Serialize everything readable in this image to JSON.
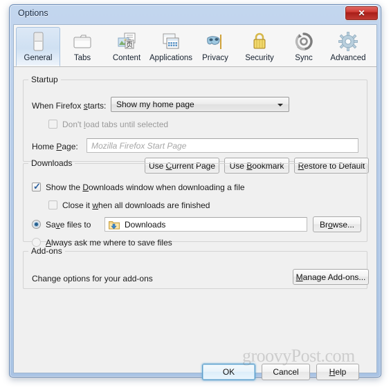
{
  "window": {
    "title": "Options",
    "close_label": "✕",
    "close_icon": "close-icon"
  },
  "tabs": [
    {
      "label": "General",
      "icon": "general-icon",
      "selected": true
    },
    {
      "label": "Tabs",
      "icon": "tabs-icon",
      "selected": false
    },
    {
      "label": "Content",
      "icon": "content-icon",
      "selected": false
    },
    {
      "label": "Applications",
      "icon": "applications-icon",
      "selected": false
    },
    {
      "label": "Privacy",
      "icon": "privacy-mask-icon",
      "selected": false
    },
    {
      "label": "Security",
      "icon": "padlock-icon",
      "selected": false
    },
    {
      "label": "Sync",
      "icon": "sync-icon",
      "selected": false
    },
    {
      "label": "Advanced",
      "icon": "gear-icon",
      "selected": false
    }
  ],
  "startup": {
    "legend": "Startup",
    "when_firefox_starts_label_a": "When Firefox ",
    "when_firefox_starts_label_b": "s",
    "when_firefox_starts_label_c": "tarts:",
    "startup_select_value": "Show my home page",
    "dont_load_tabs_a": "Don't ",
    "dont_load_tabs_b": "l",
    "dont_load_tabs_c": "oad tabs until selected",
    "dont_load_tabs_checked": false,
    "home_page_label_a": "Home ",
    "home_page_label_b": "P",
    "home_page_label_c": "age:",
    "home_page_placeholder": "Mozilla Firefox Start Page",
    "home_page_value": "",
    "use_current_page_a": "Use ",
    "use_current_page_b": "C",
    "use_current_page_c": "urrent Page",
    "use_bookmark_a": "Use ",
    "use_bookmark_b": "B",
    "use_bookmark_c": "ookmark",
    "restore_default_a": "",
    "restore_default_b": "R",
    "restore_default_c": "estore to Default"
  },
  "downloads": {
    "legend": "Downloads",
    "show_window_a": "Show the ",
    "show_window_b": "D",
    "show_window_c": "ownloads window when downloading a file",
    "show_window_checked": true,
    "close_when_done_a": "Close it ",
    "close_when_done_b": "w",
    "close_when_done_c": "hen all downloads are finished",
    "close_when_done_checked": false,
    "save_files_to_a": "Sa",
    "save_files_to_b": "v",
    "save_files_to_c": "e files to",
    "save_files_selected": true,
    "download_folder_value": "Downloads",
    "download_folder_icon": "download-folder-icon",
    "browse_a": "Br",
    "browse_b": "o",
    "browse_c": "wse...",
    "always_ask_a": "",
    "always_ask_b": "A",
    "always_ask_c": "lways ask me where to save files",
    "always_ask_selected": false
  },
  "addons": {
    "legend": "Add-ons",
    "description": "Change options for your add-ons",
    "manage_a": "",
    "manage_b": "M",
    "manage_c": "anage Add-ons..."
  },
  "footer": {
    "ok_label": "OK",
    "cancel_label": "Cancel",
    "help_a": "",
    "help_b": "H",
    "help_c": "elp"
  },
  "watermark": {
    "text": "groovyPost.com"
  },
  "colors": {
    "accent_blue": "#2b5f9e",
    "close_red": "#cf3a33",
    "window_chrome": "#b6cce9",
    "panel_bg": "#f0f0f0"
  }
}
